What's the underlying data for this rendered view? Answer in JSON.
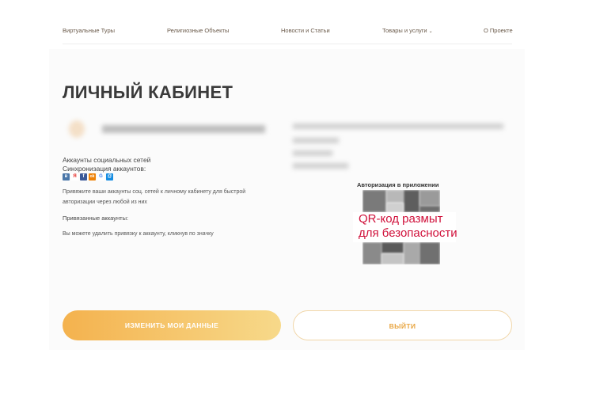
{
  "nav": {
    "items": [
      {
        "label": "Виртуальные Туры"
      },
      {
        "label": "Религиозные Объекты"
      },
      {
        "label": "Новости и Статьи"
      },
      {
        "label": "Товары и услуги",
        "dropdown_icon": "chevron-down-icon"
      },
      {
        "label": "О Проекте"
      }
    ]
  },
  "page": {
    "title": "ЛИЧНЫЙ КАБИНЕТ"
  },
  "social": {
    "title": "Аккаунты социальных сетей",
    "sync_label": "Синхронизация аккаунтов:",
    "icons": [
      {
        "name": "vk-icon",
        "color": "#4a76a8",
        "glyph": "в"
      },
      {
        "name": "yandex-icon",
        "color": "#e52620",
        "glyph": "Я"
      },
      {
        "name": "facebook-icon",
        "color": "#3b5998",
        "glyph": "f"
      },
      {
        "name": "odnoklassniki-icon",
        "color": "#ee8208",
        "glyph": "ok"
      },
      {
        "name": "google-icon",
        "color": "#ffffff",
        "glyph": "G"
      },
      {
        "name": "mailru-icon",
        "color": "#168de2",
        "glyph": "@"
      }
    ],
    "hint": "Привяжите ваши аккаунты соц. сетей к личному кабинету для быстрой авторизации через любой из них",
    "linked_label": "Привязанные аккаунты:",
    "remove_hint": "Вы можете удалить привязку к аккаунту, кликнув по значку"
  },
  "auth": {
    "label": "Авторизация в приложении",
    "redaction_line1": "QR-код размыт",
    "redaction_line2": "для безопасности"
  },
  "buttons": {
    "edit_label": "ИЗМЕНИТЬ МОИ ДАННЫЕ",
    "logout_label": "ВЫЙТИ"
  },
  "colors": {
    "accent": "#f4b24e",
    "accent_light": "#f7d98a",
    "redaction_text": "#d0103a"
  }
}
